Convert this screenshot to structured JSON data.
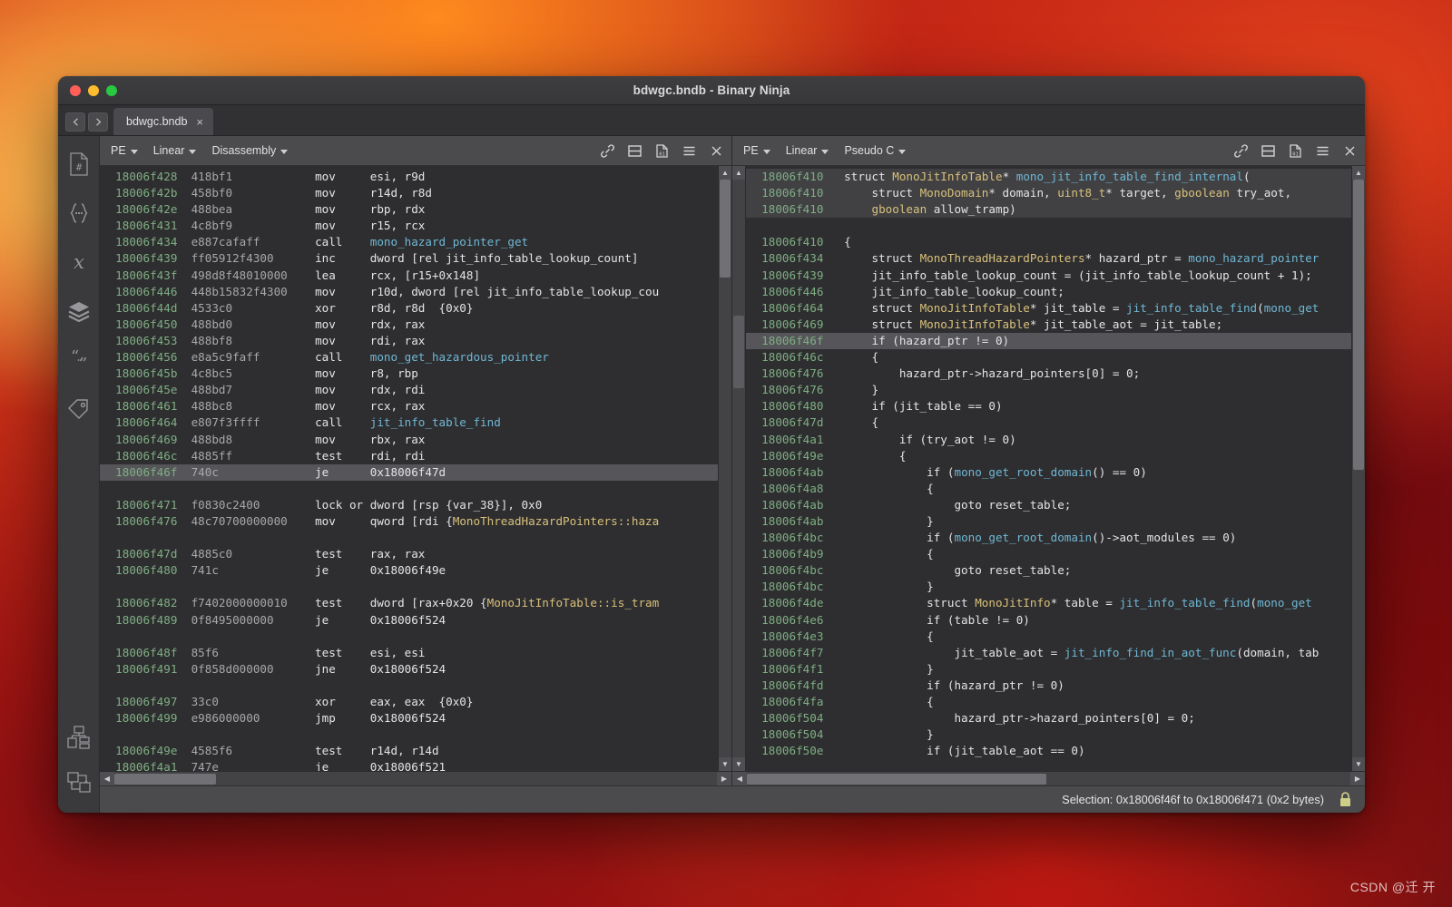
{
  "window": {
    "title": "bdwgc.bndb - Binary Ninja",
    "traffic_lights": [
      "close",
      "minimize",
      "maximize"
    ]
  },
  "tabbar": {
    "back_label": "◀",
    "forward_label": "▶",
    "tabs": [
      {
        "label": "bdwgc.bndb",
        "close_label": "×",
        "active": true
      }
    ]
  },
  "sidebar": {
    "items": [
      {
        "icon": "symbols-file-icon"
      },
      {
        "icon": "types-braces-icon"
      },
      {
        "icon": "variables-x-icon"
      },
      {
        "icon": "stack-layers-icon"
      },
      {
        "icon": "strings-quotes-icon"
      },
      {
        "icon": "tags-tag-icon"
      }
    ],
    "bottom_items": [
      {
        "icon": "cross-references-graph-icon"
      },
      {
        "icon": "call-graph-icon"
      }
    ]
  },
  "left_pane": {
    "toolbar": {
      "view_type": "PE",
      "layout": "Linear",
      "il_level": "Disassembly",
      "icons": [
        "link-icon",
        "split-pane-icon",
        "hex-file-icon",
        "options-menu-icon",
        "close-pane-icon"
      ]
    },
    "lines": [
      {
        "addr": "18006f428",
        "bytes": "418bf1",
        "mnem": "mov",
        "op": "esi, r9d"
      },
      {
        "addr": "18006f42b",
        "bytes": "458bf0",
        "mnem": "mov",
        "op": "r14d, r8d"
      },
      {
        "addr": "18006f42e",
        "bytes": "488bea",
        "mnem": "mov",
        "op": "rbp, rdx"
      },
      {
        "addr": "18006f431",
        "bytes": "4c8bf9",
        "mnem": "mov",
        "op": "r15, rcx"
      },
      {
        "addr": "18006f434",
        "bytes": "e887cafaff",
        "mnem": "call",
        "op": "mono_hazard_pointer_get",
        "op_kind": "fn"
      },
      {
        "addr": "18006f439",
        "bytes": "ff05912f4300",
        "mnem": "inc",
        "op": "dword [rel jit_info_table_lookup_count]"
      },
      {
        "addr": "18006f43f",
        "bytes": "498d8f48010000",
        "mnem": "lea",
        "op": "rcx, [r15+0x148]"
      },
      {
        "addr": "18006f446",
        "bytes": "448b15832f4300",
        "mnem": "mov",
        "op": "r10d, dword [rel jit_info_table_lookup_cou"
      },
      {
        "addr": "18006f44d",
        "bytes": "4533c0",
        "mnem": "xor",
        "op": "r8d, r8d  {0x0}"
      },
      {
        "addr": "18006f450",
        "bytes": "488bd0",
        "mnem": "mov",
        "op": "rdx, rax"
      },
      {
        "addr": "18006f453",
        "bytes": "488bf8",
        "mnem": "mov",
        "op": "rdi, rax"
      },
      {
        "addr": "18006f456",
        "bytes": "e8a5c9faff",
        "mnem": "call",
        "op": "mono_get_hazardous_pointer",
        "op_kind": "fn"
      },
      {
        "addr": "18006f45b",
        "bytes": "4c8bc5",
        "mnem": "mov",
        "op": "r8, rbp"
      },
      {
        "addr": "18006f45e",
        "bytes": "488bd7",
        "mnem": "mov",
        "op": "rdx, rdi"
      },
      {
        "addr": "18006f461",
        "bytes": "488bc8",
        "mnem": "mov",
        "op": "rcx, rax"
      },
      {
        "addr": "18006f464",
        "bytes": "e807f3ffff",
        "mnem": "call",
        "op": "jit_info_table_find",
        "op_kind": "fn"
      },
      {
        "addr": "18006f469",
        "bytes": "488bd8",
        "mnem": "mov",
        "op": "rbx, rax"
      },
      {
        "addr": "18006f46c",
        "bytes": "4885ff",
        "mnem": "test",
        "op": "rdi, rdi"
      },
      {
        "addr": "18006f46f",
        "bytes": "740c",
        "mnem": "je",
        "op": "0x18006f47d",
        "selected": true
      },
      {
        "blank": true
      },
      {
        "addr": "18006f471",
        "bytes": "f0830c2400",
        "mnem": "lock or",
        "op": "dword [rsp {var_38}], 0x0",
        "wide_mnem": true
      },
      {
        "addr": "18006f476",
        "bytes": "48c70700000000",
        "mnem": "mov",
        "op": "qword [rdi {MonoThreadHazardPointers::haza",
        "op_kind": "mixed_type",
        "op_plain": "qword [rdi {",
        "op_typed": "MonoThreadHazardPointers::haza"
      },
      {
        "blank": true
      },
      {
        "addr": "18006f47d",
        "bytes": "4885c0",
        "mnem": "test",
        "op": "rax, rax"
      },
      {
        "addr": "18006f480",
        "bytes": "741c",
        "mnem": "je",
        "op": "0x18006f49e"
      },
      {
        "blank": true
      },
      {
        "addr": "18006f482",
        "bytes": "f7402000000010",
        "mnem": "test",
        "op": "dword [rax+0x20 {MonoJitInfoTable::is_tram",
        "op_kind": "mixed_type",
        "op_plain": "dword [rax+0x20 {",
        "op_typed": "MonoJitInfoTable::is_tram"
      },
      {
        "addr": "18006f489",
        "bytes": "0f8495000000",
        "mnem": "je",
        "op": "0x18006f524"
      },
      {
        "blank": true
      },
      {
        "addr": "18006f48f",
        "bytes": "85f6",
        "mnem": "test",
        "op": "esi, esi"
      },
      {
        "addr": "18006f491",
        "bytes": "0f858d000000",
        "mnem": "jne",
        "op": "0x18006f524"
      },
      {
        "blank": true
      },
      {
        "addr": "18006f497",
        "bytes": "33c0",
        "mnem": "xor",
        "op": "eax, eax  {0x0}"
      },
      {
        "addr": "18006f499",
        "bytes": "e986000000",
        "mnem": "jmp",
        "op": "0x18006f524"
      },
      {
        "blank": true
      },
      {
        "addr": "18006f49e",
        "bytes": "4585f6",
        "mnem": "test",
        "op": "r14d, r14d"
      },
      {
        "addr": "18006f4a1",
        "bytes": "747e",
        "mnem": "je",
        "op": "0x18006f521"
      }
    ]
  },
  "right_pane": {
    "toolbar": {
      "view_type": "PE",
      "layout": "Linear",
      "il_level": "Pseudo C",
      "icons": [
        "link-icon",
        "split-pane-icon",
        "hex-file-icon",
        "options-menu-icon",
        "close-pane-icon"
      ]
    },
    "lines": [
      {
        "addr": "18006f410",
        "indent": 0,
        "header": true,
        "text": "struct MonoJitInfoTable* mono_jit_info_table_find_internal("
      },
      {
        "addr": "18006f410",
        "indent": 1,
        "header": true,
        "text": "struct MonoDomain* domain, uint8_t* target, gboolean try_aot,"
      },
      {
        "addr": "18006f410",
        "indent": 1,
        "header": true,
        "text": "gboolean allow_tramp)"
      },
      {
        "blank": true
      },
      {
        "addr": "18006f410",
        "indent": 0,
        "text": "{"
      },
      {
        "addr": "18006f434",
        "indent": 1,
        "text": "struct MonoThreadHazardPointers* hazard_ptr = mono_hazard_pointer"
      },
      {
        "addr": "18006f439",
        "indent": 1,
        "text": "jit_info_table_lookup_count = (jit_info_table_lookup_count + 1);"
      },
      {
        "addr": "18006f446",
        "indent": 1,
        "text": "jit_info_table_lookup_count;"
      },
      {
        "addr": "18006f464",
        "indent": 1,
        "text": "struct MonoJitInfoTable* jit_table = jit_info_table_find(mono_get"
      },
      {
        "addr": "18006f469",
        "indent": 1,
        "text": "struct MonoJitInfoTable* jit_table_aot = jit_table;"
      },
      {
        "addr": "18006f46f",
        "indent": 1,
        "text": "if (hazard_ptr != 0)",
        "selected": true
      },
      {
        "addr": "18006f46c",
        "indent": 1,
        "text": "{"
      },
      {
        "addr": "18006f476",
        "indent": 2,
        "text": "hazard_ptr->hazard_pointers[0] = 0;"
      },
      {
        "addr": "18006f476",
        "indent": 1,
        "text": "}"
      },
      {
        "addr": "18006f480",
        "indent": 1,
        "text": "if (jit_table == 0)"
      },
      {
        "addr": "18006f47d",
        "indent": 1,
        "text": "{"
      },
      {
        "addr": "18006f4a1",
        "indent": 2,
        "text": "if (try_aot != 0)"
      },
      {
        "addr": "18006f49e",
        "indent": 2,
        "text": "{"
      },
      {
        "addr": "18006f4ab",
        "indent": 3,
        "text": "if (mono_get_root_domain() == 0)"
      },
      {
        "addr": "18006f4a8",
        "indent": 3,
        "text": "{"
      },
      {
        "addr": "18006f4ab",
        "indent": 4,
        "text": "goto reset_table;"
      },
      {
        "addr": "18006f4ab",
        "indent": 3,
        "text": "}"
      },
      {
        "addr": "18006f4bc",
        "indent": 3,
        "text": "if (mono_get_root_domain()->aot_modules == 0)"
      },
      {
        "addr": "18006f4b9",
        "indent": 3,
        "text": "{"
      },
      {
        "addr": "18006f4bc",
        "indent": 4,
        "text": "goto reset_table;"
      },
      {
        "addr": "18006f4bc",
        "indent": 3,
        "text": "}"
      },
      {
        "addr": "18006f4de",
        "indent": 3,
        "text": "struct MonoJitInfo* table = jit_info_table_find(mono_get"
      },
      {
        "addr": "18006f4e6",
        "indent": 3,
        "text": "if (table != 0)"
      },
      {
        "addr": "18006f4e3",
        "indent": 3,
        "text": "{"
      },
      {
        "addr": "18006f4f7",
        "indent": 4,
        "text": "jit_table_aot = jit_info_find_in_aot_func(domain, tab"
      },
      {
        "addr": "18006f4f1",
        "indent": 3,
        "text": "}"
      },
      {
        "addr": "18006f4fd",
        "indent": 3,
        "text": "if (hazard_ptr != 0)"
      },
      {
        "addr": "18006f4fa",
        "indent": 3,
        "text": "{"
      },
      {
        "addr": "18006f504",
        "indent": 4,
        "text": "hazard_ptr->hazard_pointers[0] = 0;"
      },
      {
        "addr": "18006f504",
        "indent": 3,
        "text": "}"
      },
      {
        "addr": "18006f50e",
        "indent": 3,
        "text": "if (jit_table_aot == 0)"
      }
    ]
  },
  "statusbar": {
    "selection_text": "Selection: 0x18006f46f to 0x18006f471 (0x2 bytes)",
    "lock_icon": "lock-icon"
  },
  "watermark": {
    "text": "CSDN @迁  开"
  },
  "colors": {
    "address": "#7fae83",
    "bytes": "#a8a8ab",
    "instruction": "#e4e4e6",
    "function_name": "#6fb7d4",
    "type_name": "#d8c07a",
    "selection_row": "#56565a",
    "code_background": "#2e2e30",
    "toolbar_background": "#4b4b4e",
    "window_chrome": "#3a3a3c"
  }
}
